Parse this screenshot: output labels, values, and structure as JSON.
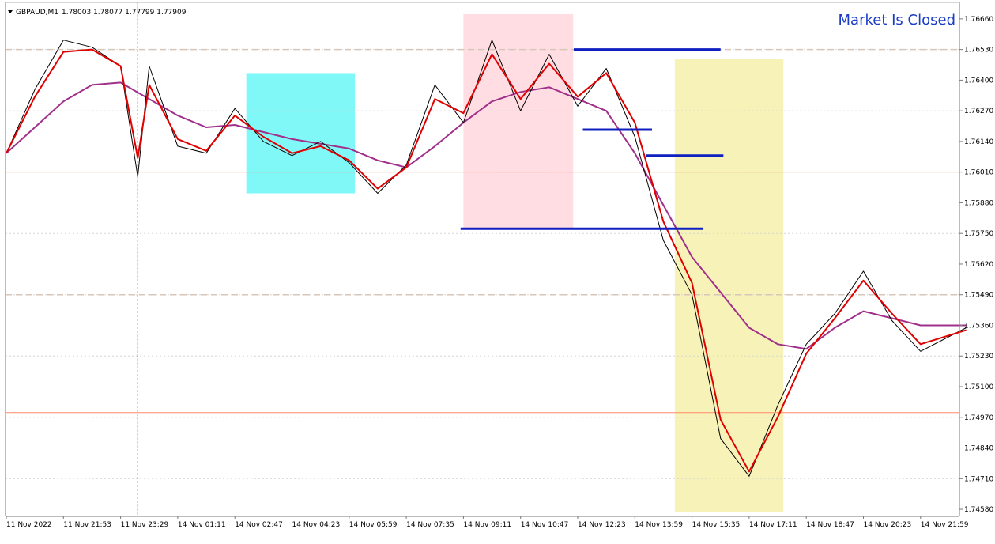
{
  "header": {
    "symbol": "GBPAUD,M1",
    "ohlc": "1.78003 1.78077 1.77799 1.77909",
    "status": "Market Is Closed"
  },
  "colors": {
    "background": "#ffffff",
    "price_line": "#000000",
    "fast_ma": "#e00000",
    "slow_ma": "#a0308a",
    "level_line": "#ff8a6a",
    "dashed_level": "#d8c6b8",
    "support_resistance": "#1020c0",
    "zone_cyan": "#80f8f8",
    "zone_pink": "#ffdde3",
    "zone_yellow": "#f6f2b8",
    "status_text": "#1b3cc7",
    "session_separator": "#6a2c8a"
  },
  "chart_data": {
    "type": "line",
    "title": "GBPAUD,M1",
    "y_ticks": [
      1.7666,
      1.7653,
      1.764,
      1.7627,
      1.7614,
      1.7601,
      1.7588,
      1.7575,
      1.7562,
      1.7549,
      1.7536,
      1.7523,
      1.751,
      1.7497,
      1.7484,
      1.7471,
      1.7458
    ],
    "y_tick_labels": [
      "1.76660",
      "1.76530",
      "1.76400",
      "1.76270",
      "1.76140",
      "1.76010",
      "1.75880",
      "1.75750",
      "1.75620",
      "1.75490",
      "1.75360",
      "1.75230",
      "1.75100",
      "1.74970",
      "1.74840",
      "1.74710",
      "1.74580"
    ],
    "ylim": [
      1.7455,
      1.7673
    ],
    "x_tick_labels": [
      "11 Nov 2022",
      "11 Nov 21:53",
      "11 Nov 23:29",
      "14 Nov 01:11",
      "14 Nov 02:47",
      "14 Nov 04:23",
      "14 Nov 05:59",
      "14 Nov 07:35",
      "14 Nov 09:11",
      "14 Nov 10:47",
      "14 Nov 12:23",
      "14 Nov 13:59",
      "14 Nov 15:35",
      "14 Nov 17:11",
      "14 Nov 18:47",
      "14 Nov 20:23",
      "14 Nov 21:59"
    ],
    "grid": false,
    "series": [
      {
        "x": [
          0,
          0.5,
          1,
          1.5,
          2,
          2.3,
          2.5,
          3,
          3.5,
          4,
          4.5,
          5,
          5.5,
          6,
          6.5,
          7,
          7.5,
          8,
          8.5,
          9,
          9.5,
          10,
          10.5,
          11,
          11.5,
          12,
          12.5,
          13,
          13.5,
          14,
          14.5,
          15,
          15.5,
          16,
          16.8
        ],
        "values": [
          1.7609,
          1.7636,
          1.7657,
          1.7654,
          1.7646,
          1.7599,
          1.7646,
          1.7612,
          1.7609,
          1.7628,
          1.7614,
          1.7608,
          1.7614,
          1.7605,
          1.7592,
          1.7604,
          1.7638,
          1.7622,
          1.7657,
          1.7627,
          1.7651,
          1.7629,
          1.7645,
          1.7616,
          1.7572,
          1.7549,
          1.7488,
          1.7472,
          1.7502,
          1.7528,
          1.7541,
          1.7559,
          1.7538,
          1.7525,
          1.7535
        ]
      },
      {
        "x": [
          0,
          0.5,
          1,
          1.5,
          2,
          2.3,
          2.5,
          3,
          3.5,
          4,
          4.5,
          5,
          5.5,
          6,
          6.5,
          7,
          7.5,
          8,
          8.5,
          9,
          9.5,
          10,
          10.5,
          11,
          11.5,
          12,
          12.5,
          13,
          13.5,
          14,
          14.5,
          15,
          15.5,
          16,
          16.8
        ],
        "values": [
          1.7609,
          1.7633,
          1.7652,
          1.7653,
          1.7646,
          1.7607,
          1.7638,
          1.7615,
          1.761,
          1.7625,
          1.7616,
          1.7609,
          1.7612,
          1.7606,
          1.7594,
          1.7603,
          1.7632,
          1.7626,
          1.7651,
          1.7632,
          1.7647,
          1.7633,
          1.7643,
          1.7622,
          1.758,
          1.7554,
          1.7496,
          1.7474,
          1.7497,
          1.7524,
          1.7539,
          1.7555,
          1.7541,
          1.7528,
          1.7534
        ]
      },
      {
        "x": [
          0,
          1,
          1.5,
          2,
          2.5,
          3,
          3.5,
          4,
          4.5,
          5,
          5.5,
          6,
          6.5,
          7,
          7.5,
          8,
          8.5,
          9,
          9.5,
          10,
          10.5,
          11,
          11.5,
          12,
          12.5,
          13,
          13.5,
          14,
          14.5,
          15,
          15.5,
          16,
          16.8
        ],
        "values": [
          1.7609,
          1.7631,
          1.7638,
          1.7639,
          1.7632,
          1.7625,
          1.762,
          1.7621,
          1.7618,
          1.7615,
          1.7613,
          1.7611,
          1.7606,
          1.7603,
          1.7612,
          1.7622,
          1.7631,
          1.7635,
          1.7637,
          1.7632,
          1.7627,
          1.7609,
          1.7587,
          1.7565,
          1.755,
          1.7535,
          1.7528,
          1.7526,
          1.7535,
          1.7542,
          1.7539,
          1.7536,
          1.7536
        ]
      }
    ],
    "horizontal_levels": [
      1.7601,
      1.7499,
      1.7653,
      1.7549
    ],
    "support_resistance_lines": [
      {
        "x_start": 9.93,
        "x_end": 12.5,
        "y": 1.7653
      },
      {
        "x_start": 10.09,
        "x_end": 11.3,
        "y": 1.7619
      },
      {
        "x_start": 11.2,
        "x_end": 12.55,
        "y": 1.7608
      },
      {
        "x_start": 7.95,
        "x_end": 12.2,
        "y": 1.7577
      }
    ],
    "zones": [
      {
        "x_start": 4.2,
        "x_end": 6.1,
        "y_top": 1.7643,
        "y_bottom": 1.7592
      },
      {
        "x_start": 8.0,
        "x_end": 9.92,
        "y_top": 1.7668,
        "y_bottom": 1.7577
      },
      {
        "x_start": 11.7,
        "x_end": 13.6,
        "y_top": 1.7649,
        "y_bottom": 1.7457
      }
    ],
    "session_separator_x": 2.3
  }
}
